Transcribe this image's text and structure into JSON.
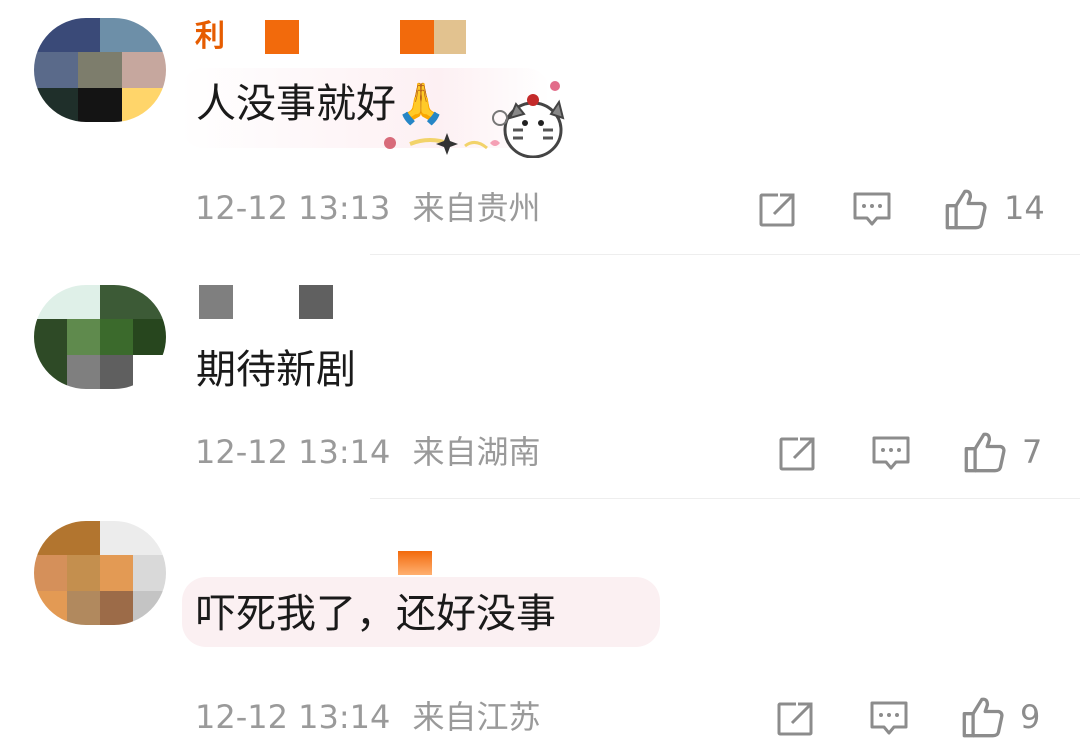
{
  "comments": [
    {
      "text": "人没事就好🙏",
      "time": "12-12 13:13",
      "location": "来自贵州",
      "likes": "14",
      "username_partial": "利",
      "sticker": "cat-sticker",
      "avatar_colors": [
        "#3a4a78",
        "#6d8fa8",
        "#5a6a8a",
        "#7d7d6c",
        "#c6a79e",
        "#2a2a3a",
        "#1f2f2a",
        "#141414",
        "#ffd56a"
      ]
    },
    {
      "text": "期待新剧",
      "time": "12-12 13:14",
      "location": "来自湖南",
      "likes": "7",
      "avatar_colors": [
        "#dff0e8",
        "#3c5a36",
        "#2e4a26",
        "#5f8a4d",
        "#3b6a2c",
        "#27461e",
        "#7f7f7f",
        "#5f5f5f"
      ]
    },
    {
      "text": "吓死我了，还好没事",
      "time": "12-12 13:14",
      "location": "来自江苏",
      "likes": "9",
      "avatar_colors": [
        "#b2752f",
        "#d5905a",
        "#c48f4e",
        "#e39a54",
        "#b1895e",
        "#9c6b48",
        "#c9a07d",
        "#c4c4c4"
      ]
    }
  ],
  "icons": {
    "share": "share-icon",
    "comment": "comment-icon",
    "like": "thumb-up-icon"
  },
  "colors": {
    "meta": "#9a9a9a",
    "text": "#1a1a1a",
    "badge_orange": "#f26a0c"
  }
}
